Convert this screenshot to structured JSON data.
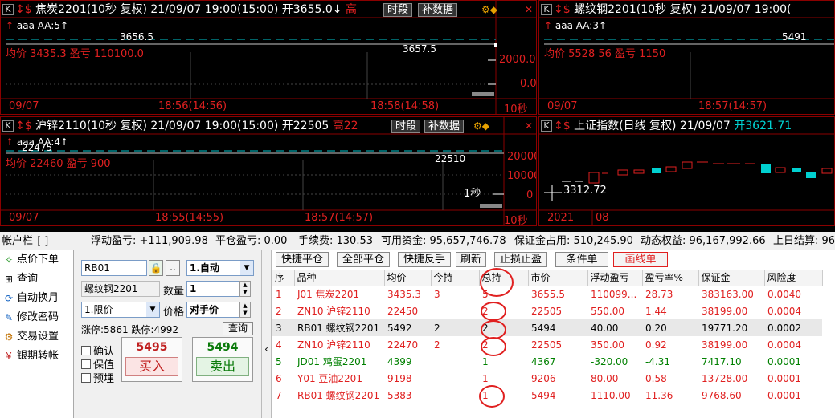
{
  "pane1": {
    "title": "焦炭2201(10秒 复权) 21/09/07 19:00(15:00) 开3655.0↓",
    "high_label": "高",
    "btn_time": "时段",
    "btn_data": "补数据",
    "sub": "aaa AA:5↑",
    "avg_text": "均价 3435.3 盈亏 110100.0",
    "price_top": "3656.5",
    "price_mid": "3657.5",
    "axis_vals": [
      "2000.0",
      "0.0"
    ],
    "time_labels": [
      "09/07",
      "18:56(14:56)",
      "18:58(14:58)",
      "10秒"
    ]
  },
  "pane2": {
    "title": "螺纹钢2201(10秒 复权) 21/09/07 19:00(",
    "sub": "aaa AA:3↑",
    "avg_text": "均价 5528 56 盈亏 1150",
    "price_top": "5491",
    "time_labels": [
      "09/07",
      "18:57(14:57)"
    ]
  },
  "pane3": {
    "title": "沪锌2110(10秒 复权) 21/09/07 19:00(15:00) 开22505",
    "high_label": "高22",
    "btn_time": "时段",
    "btn_data": "补数据",
    "sub": "aaa AA:4↑",
    "avg_text": "均价 22460 盈亏 900",
    "price_top": "22475",
    "price_mid": "22510",
    "label_1s": "1秒",
    "axis_vals": [
      "20000",
      "10000",
      "0"
    ],
    "time_labels": [
      "09/07",
      "18:55(14:55)",
      "18:57(14:57)",
      "10秒"
    ]
  },
  "pane4": {
    "title": "上证指数(日线 复权) 21/09/07",
    "title_val": "开3621.71",
    "low_label": "3312.72",
    "time_labels": [
      "2021",
      "08"
    ]
  },
  "status": {
    "account_label": "帐户栏",
    "account_val": "[       ]",
    "float_pl": "浮动盈亏: +111,909.98",
    "close_pl": "平仓盈亏: 0.00",
    "fee": "手续费: 130.53",
    "avail": "可用资金: 95,657,746.78",
    "margin": "保证金占用: 510,245.90",
    "equity": "动态权益: 96,167,992.66",
    "settle": "上日结算: 96,"
  },
  "nav": [
    {
      "icon": "✧",
      "label": "点价下单"
    },
    {
      "icon": "⊞",
      "label": "查询"
    },
    {
      "icon": "⟳",
      "label": "自动换月"
    },
    {
      "icon": "✎",
      "label": "修改密码"
    },
    {
      "icon": "⚙",
      "label": "交易设置"
    },
    {
      "icon": "¥",
      "label": "银期转帐"
    }
  ],
  "order": {
    "code": "RB01",
    "mode": "1.自动",
    "name": "螺纹钢2201",
    "qty_label": "数量",
    "qty": "1",
    "price_type": "1.限价",
    "price_label": "价格",
    "price_val": "对手价",
    "limit_up": "涨停:5861",
    "limit_down": "跌停:4992",
    "query_btn": "查询",
    "confirm": "确认",
    "keep": "保值",
    "preorder": "预埋",
    "buy_price": "5495",
    "buy_label": "买入",
    "sell_price": "5494",
    "sell_label": "卖出"
  },
  "toolbar": [
    "快捷平仓",
    "全部平仓",
    "快捷反手",
    "刷新",
    "止损止盈",
    "条件单",
    "画线单"
  ],
  "table": {
    "headers": [
      "序",
      "品种",
      "均价",
      "今持",
      "总持",
      "市价",
      "浮动盈亏",
      "盈亏率%",
      "保证金",
      "风险度"
    ],
    "rows": [
      {
        "c": [
          "1",
          "J01 焦炭2201",
          "3435.3",
          "3",
          "5",
          "3655.5",
          "110099...",
          "28.73",
          "383163.00",
          "0.0040"
        ],
        "color": "#e02020"
      },
      {
        "c": [
          "2",
          "ZN10 沪锌2110",
          "22450",
          "",
          "2",
          "22505",
          "550.00",
          "1.44",
          "38199.00",
          "0.0004"
        ],
        "color": "#e02020"
      },
      {
        "c": [
          "3",
          "RB01 螺纹钢2201",
          "5492",
          "2",
          "2",
          "5494",
          "40.00",
          "0.20",
          "19771.20",
          "0.0002"
        ],
        "color": "#000000"
      },
      {
        "c": [
          "4",
          "ZN10 沪锌2110",
          "22470",
          "2",
          "2",
          "22505",
          "350.00",
          "0.92",
          "38199.00",
          "0.0004"
        ],
        "color": "#e02020"
      },
      {
        "c": [
          "5",
          "JD01 鸡蛋2201",
          "4399",
          "",
          "1",
          "4367",
          "-320.00",
          "-4.31",
          "7417.10",
          "0.0001"
        ],
        "color": "#008000"
      },
      {
        "c": [
          "6",
          "Y01 豆油2201",
          "9198",
          "",
          "1",
          "9206",
          "80.00",
          "0.58",
          "13728.00",
          "0.0001"
        ],
        "color": "#e02020"
      },
      {
        "c": [
          "7",
          "RB01 螺纹钢2201",
          "5383",
          "",
          "1",
          "5494",
          "1110.00",
          "11.36",
          "9768.60",
          "0.0001"
        ],
        "color": "#e02020"
      }
    ]
  },
  "colors": {
    "up": "#e02020",
    "down": "#00d0d0",
    "grid": "#8b0000"
  }
}
